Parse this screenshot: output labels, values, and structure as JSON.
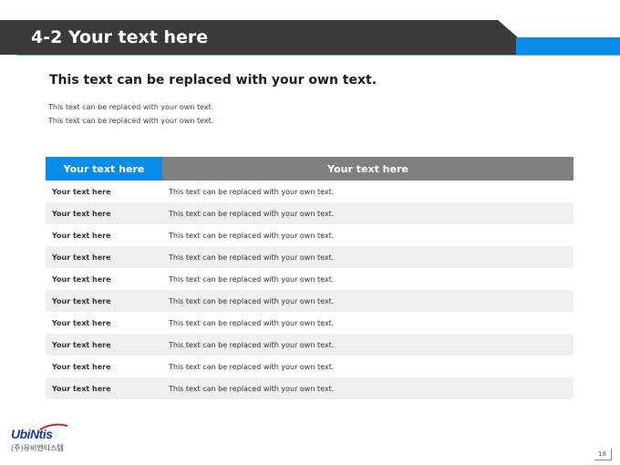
{
  "header": {
    "title": "4-2 Your text here"
  },
  "content": {
    "subtitle": "This text can be replaced with your own text.",
    "body_lines": [
      "This text can be replaced with your own text.",
      "This text can be replaced with your own text."
    ]
  },
  "table": {
    "headers": [
      "Your text here",
      "Your text here"
    ],
    "rows": [
      [
        "Your text here",
        "This text can be replaced with your own text."
      ],
      [
        "Your text here",
        "This text can be replaced with your own text."
      ],
      [
        "Your text here",
        "This text can be replaced with your own text."
      ],
      [
        "Your text here",
        "This text can be replaced with your own text."
      ],
      [
        "Your text here",
        "This text can be replaced with your own text."
      ],
      [
        "Your text here",
        "This text can be replaced with your own text."
      ],
      [
        "Your text here",
        "This text can be replaced with your own text."
      ],
      [
        "Your text here",
        "This text can be replaced with your own text."
      ],
      [
        "Your text here",
        "This text can be replaced with your own text."
      ],
      [
        "Your text here",
        "This text can be replaced with your own text."
      ]
    ]
  },
  "footer": {
    "logo_text": "UbiNtis",
    "logo_subtext": "(주)유비엔티스템",
    "page_number": "18"
  },
  "colors": {
    "header_bg": "#3a3a3a",
    "accent": "#0a8de8",
    "table_header_gray": "#808080",
    "row_alt": "#f0f0f0"
  }
}
